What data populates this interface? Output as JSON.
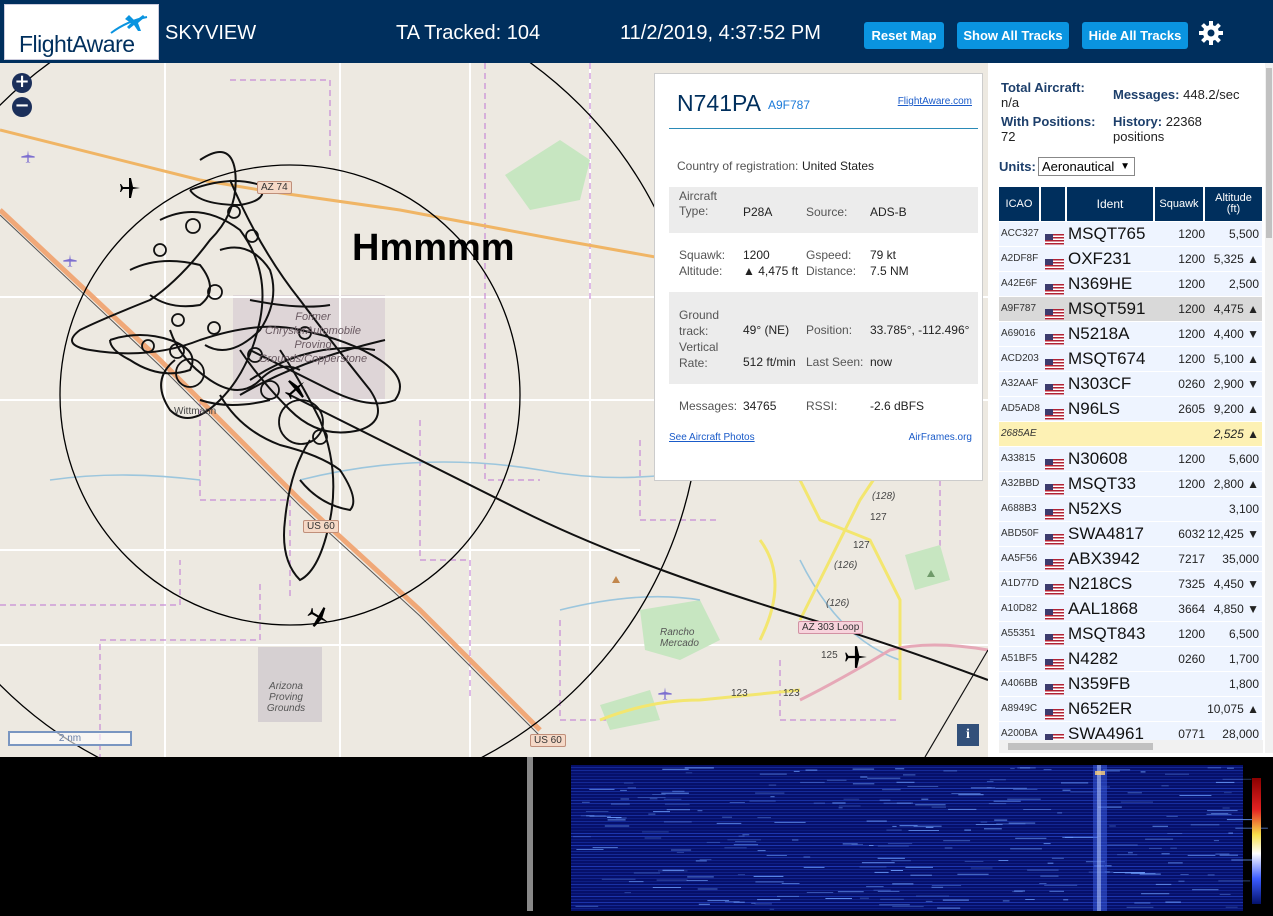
{
  "header": {
    "logo_text": "FlightAware",
    "app_name": "SKYVIEW",
    "tracked": "TA Tracked: 104",
    "datetime": "11/2/2019, 4:37:52 PM",
    "buttons": {
      "reset": "Reset Map",
      "show_all": "Show All Tracks",
      "hide_all": "Hide All Tracks"
    },
    "colors": {
      "bar": "#002f5d",
      "button": "#0a94e0"
    }
  },
  "map": {
    "zoom_in": "+",
    "zoom_out": "−",
    "overlay_text": "Hmmmm",
    "labels": {
      "az74": "AZ 74",
      "us60a": "US 60",
      "us60b": "US 60",
      "wittmann": "Wittmann",
      "chrysler": "Former ChryslerAutomobile Proving Grounds/Copperstone",
      "rancho": "Rancho Mercado",
      "arizona_pg": "Arizona Proving Grounds",
      "loop303": "AZ 303 Loop",
      "r128": "(128)",
      "r127a": "127",
      "r127b": "127",
      "r126a": "(126)",
      "r126b": "(126)",
      "r125": "125",
      "r123a": "123",
      "r123b": "123"
    },
    "scale": "2 nm",
    "info": "i"
  },
  "popup": {
    "callsign": "N741PA",
    "hex": "A9F787",
    "link": "FlightAware.com",
    "country_label": "Country of registration:",
    "country": "United States",
    "aircraft_type_label": "Aircraft Type:",
    "aircraft_type": "P28A",
    "source_label": "Source:",
    "source": "ADS-B",
    "squawk_label": "Squawk:",
    "squawk": "1200",
    "altitude_label": "Altitude:",
    "altitude": "▲ 4,475 ft",
    "gspeed_label": "Gspeed:",
    "gspeed": "79 kt",
    "distance_label": "Distance:",
    "distance": "7.5 NM",
    "track_label": "Ground track:",
    "track": "49° (NE)",
    "position_label": "Position:",
    "position": "33.785°, -112.496°",
    "vrate_label": "Vertical Rate:",
    "vrate": "512 ft/min",
    "lastseen_label": "Last Seen:",
    "lastseen": "now",
    "messages_label": "Messages:",
    "messages": "34765",
    "rssi_label": "RSSI:",
    "rssi": "-2.6 dBFS",
    "photos_link": "See Aircraft Photos",
    "airframes_link": "AirFrames.org"
  },
  "stats": {
    "total_label": "Total Aircraft:",
    "total": "n/a",
    "messages_label": "Messages:",
    "messages": "448.2/sec",
    "positions_label": "With Positions:",
    "positions": "72",
    "history_label": "History:",
    "history": "22368 positions",
    "units_label": "Units:",
    "units": "Aeronautical"
  },
  "table": {
    "headers": {
      "icao": "ICAO",
      "ident": "Ident",
      "squawk": "Squawk",
      "altitude": "Altitude (ft)"
    },
    "rows": [
      {
        "icao": "ACC327",
        "ident": "MSQT765",
        "squawk": "1200",
        "alt": "5,500"
      },
      {
        "icao": "A2DF8F",
        "ident": "OXF231",
        "squawk": "1200",
        "alt": "5,325 ▲"
      },
      {
        "icao": "A42E6F",
        "ident": "N369HE",
        "squawk": "1200",
        "alt": "2,500"
      },
      {
        "icao": "A9F787",
        "ident": "MSQT591",
        "squawk": "1200",
        "alt": "4,475 ▲"
      },
      {
        "icao": "A69016",
        "ident": "N5218A",
        "squawk": "1200",
        "alt": "4,400 ▼"
      },
      {
        "icao": "ACD203",
        "ident": "MSQT674",
        "squawk": "1200",
        "alt": "5,100 ▲"
      },
      {
        "icao": "A32AAF",
        "ident": "N303CF",
        "squawk": "0260",
        "alt": "2,900 ▼"
      },
      {
        "icao": "AD5AD8",
        "ident": "N96LS",
        "squawk": "2605",
        "alt": "9,200 ▲"
      },
      {
        "icao": "2685AE",
        "ident": "",
        "squawk": "",
        "alt": "2,525 ▲"
      },
      {
        "icao": "A33815",
        "ident": "N30608",
        "squawk": "1200",
        "alt": "5,600"
      },
      {
        "icao": "A32BBD",
        "ident": "MSQT33",
        "squawk": "1200",
        "alt": "2,800 ▲"
      },
      {
        "icao": "A688B3",
        "ident": "N52XS",
        "squawk": "",
        "alt": "3,100"
      },
      {
        "icao": "ABD50F",
        "ident": "SWA4817",
        "squawk": "6032",
        "alt": "12,425 ▼"
      },
      {
        "icao": "AA5F56",
        "ident": "ABX3942",
        "squawk": "7217",
        "alt": "35,000"
      },
      {
        "icao": "A1D77D",
        "ident": "N218CS",
        "squawk": "7325",
        "alt": "4,450 ▼"
      },
      {
        "icao": "A10D82",
        "ident": "AAL1868",
        "squawk": "3664",
        "alt": "4,850 ▼"
      },
      {
        "icao": "A55351",
        "ident": "MSQT843",
        "squawk": "1200",
        "alt": "6,500"
      },
      {
        "icao": "A51BF5",
        "ident": "N4282",
        "squawk": "0260",
        "alt": "1,700"
      },
      {
        "icao": "A406BB",
        "ident": "N359FB",
        "squawk": "",
        "alt": "1,800"
      },
      {
        "icao": "A8949C",
        "ident": "N652ER",
        "squawk": "",
        "alt": "10,075 ▲"
      },
      {
        "icao": "A200BA",
        "ident": "SWA4961",
        "squawk": "0771",
        "alt": "28,000"
      }
    ]
  }
}
